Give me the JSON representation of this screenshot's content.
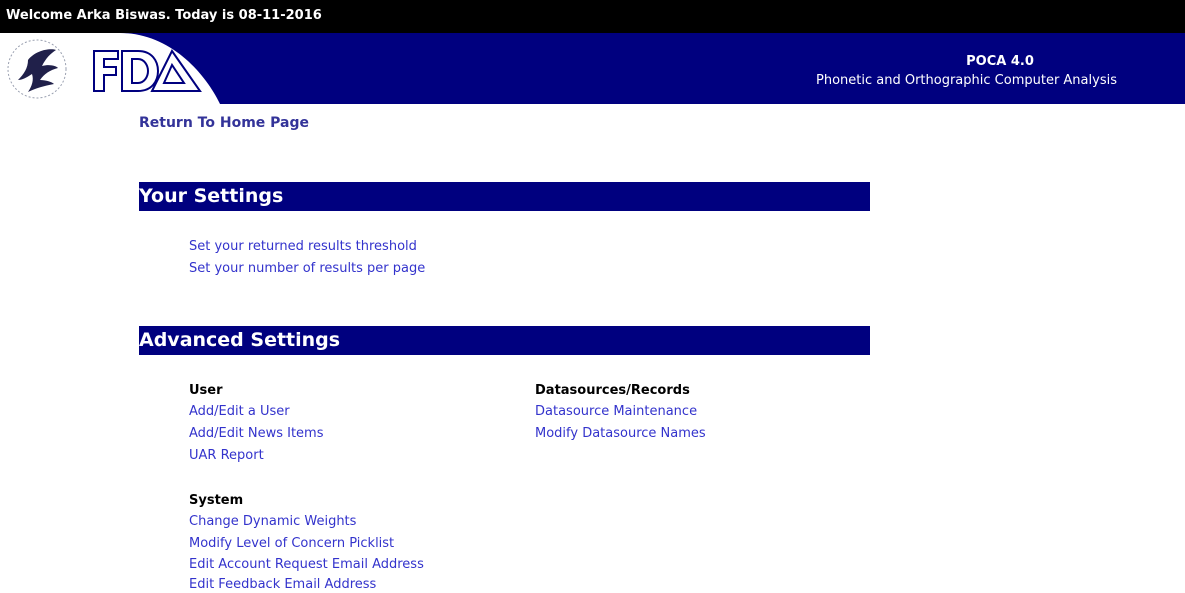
{
  "topbar": {
    "welcome": "Welcome Arka Biswas. Today is 08-11-2016"
  },
  "banner": {
    "title": "POCA 4.0",
    "subtitle": "Phonetic and Orthographic Computer Analysis",
    "logo_text": "FDA",
    "brand_color": "#00007f"
  },
  "nav": {
    "home": "Return To Home Page"
  },
  "your_settings": {
    "heading": "Your Settings",
    "links": [
      "Set your returned results threshold",
      "Set your number of results per page"
    ]
  },
  "advanced_settings": {
    "heading": "Advanced Settings",
    "user": {
      "heading": "User",
      "links": [
        "Add/Edit a User",
        "Add/Edit News Items",
        "UAR Report"
      ]
    },
    "datasources": {
      "heading": "Datasources/Records",
      "links": [
        "Datasource Maintenance",
        "Modify Datasource Names"
      ]
    },
    "system": {
      "heading": "System",
      "links": [
        "Change Dynamic Weights",
        "Modify Level of Concern Picklist",
        "Edit Account Request Email Address",
        "Edit Feedback Email Address"
      ]
    }
  }
}
